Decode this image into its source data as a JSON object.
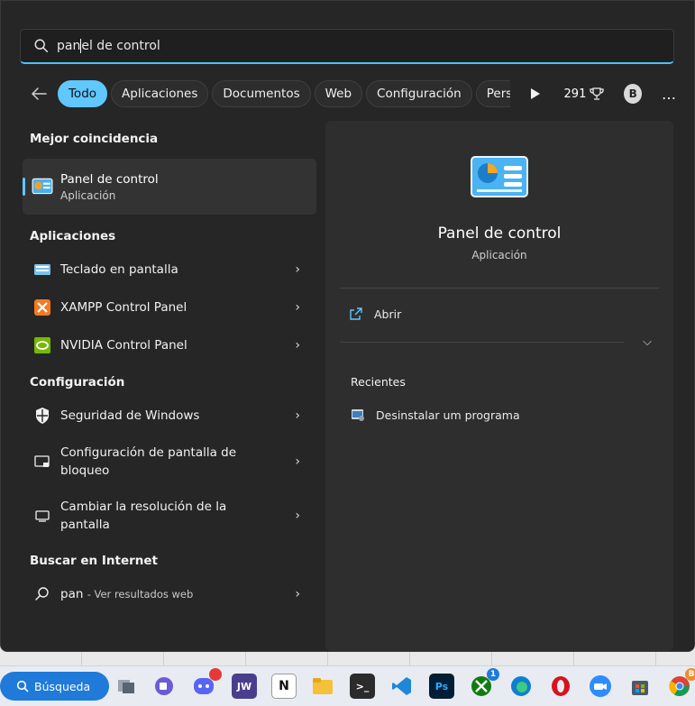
{
  "search": {
    "typed": "pan",
    "rest": "el de control"
  },
  "filters": {
    "chips": [
      "Todo",
      "Aplicaciones",
      "Documentos",
      "Web",
      "Configuración",
      "Pers"
    ],
    "points": "291"
  },
  "user": {
    "initial": "B"
  },
  "more_label": "…",
  "best_match": {
    "section": "Mejor coincidencia",
    "name": "Panel de control",
    "type": "Aplicación"
  },
  "apps": {
    "section": "Aplicaciones",
    "items": [
      {
        "label": "Teclado en pantalla",
        "icon": "keyboard-icon"
      },
      {
        "label": "XAMPP Control Panel",
        "icon": "xampp-icon"
      },
      {
        "label": "NVIDIA Control Panel",
        "icon": "nvidia-icon"
      }
    ]
  },
  "settings": {
    "section": "Configuración",
    "items": [
      {
        "label": "Seguridad de Windows",
        "icon": "shield-icon"
      },
      {
        "label": "Configuración de pantalla de bloqueo",
        "icon": "lock-screen-icon"
      },
      {
        "label": "Cambiar la resolución de la pantalla",
        "icon": "monitor-icon"
      }
    ]
  },
  "web": {
    "section": "Buscar en Internet",
    "query": "pan",
    "hint": "- Ver resultados web"
  },
  "detail": {
    "title": "Panel de control",
    "subtitle": "Aplicación",
    "open_label": "Abrir",
    "recent_title": "Recientes",
    "recent_items": [
      "Desinstalar um programa"
    ]
  },
  "taskbar": {
    "search_label": "Búsqueda",
    "apps": [
      "task-view",
      "meet",
      "discord",
      "jw",
      "notion",
      "explorer",
      "terminal",
      "vscode",
      "photoshop",
      "xbox",
      "edge",
      "opera",
      "zoom",
      "store",
      "chrome"
    ],
    "xbox_badge": "1",
    "chrome_badge": "B"
  },
  "colors": {
    "accent": "#60c7ff",
    "panel_bg": "#262626",
    "detail_bg": "#2e2e2e",
    "taskbar_search": "#1f7ad9"
  }
}
